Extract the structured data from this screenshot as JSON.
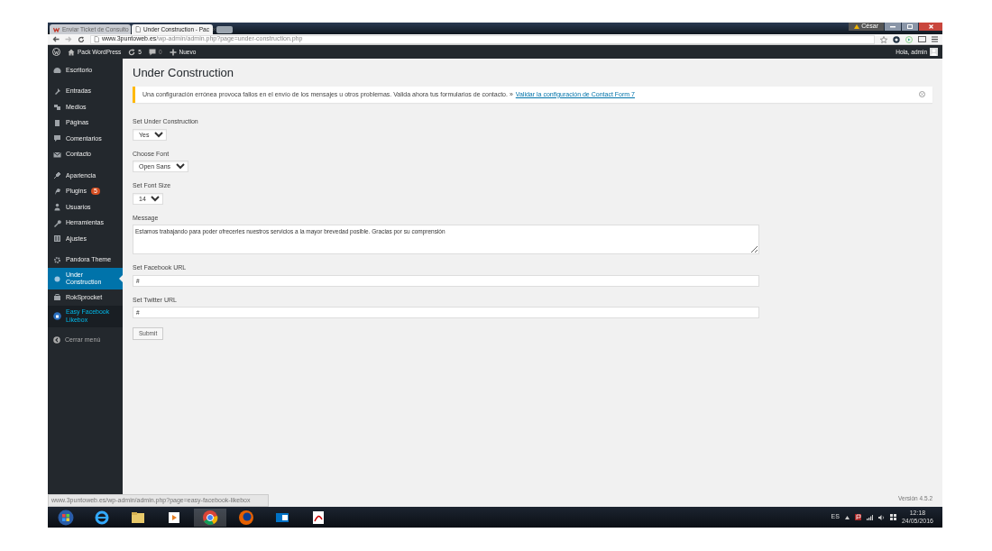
{
  "browser": {
    "tabs": [
      {
        "title": "Enviar Ticket de Consulto",
        "selected": false
      },
      {
        "title": "Under Construction - Pac",
        "selected": true
      }
    ],
    "user_badge": "César",
    "url_host": "www.3puntoweb.es",
    "url_path": "/wp-admin/admin.php?page=under-construction.php"
  },
  "admin_bar": {
    "site": "Pack WordPress",
    "updates": "5",
    "comments": "0",
    "new": "Nuevo",
    "greeting": "Hola, admin"
  },
  "sidebar": {
    "groups": [
      [
        {
          "label": "Escritorio",
          "selected": false,
          "hovered": false
        }
      ],
      [
        {
          "label": "Entradas",
          "selected": false,
          "hovered": false
        },
        {
          "label": "Medios",
          "selected": false,
          "hovered": false
        },
        {
          "label": "Páginas",
          "selected": false,
          "hovered": false
        },
        {
          "label": "Comentarios",
          "selected": false,
          "hovered": false
        },
        {
          "label": "Contacto",
          "selected": false,
          "hovered": false
        }
      ],
      [
        {
          "label": "Apariencia",
          "selected": false,
          "hovered": false
        },
        {
          "label": "Plugins",
          "badge": "5",
          "selected": false,
          "hovered": false
        },
        {
          "label": "Usuarios",
          "selected": false,
          "hovered": false
        },
        {
          "label": "Herramientas",
          "selected": false,
          "hovered": false
        },
        {
          "label": "Ajustes",
          "selected": false,
          "hovered": false
        }
      ],
      [
        {
          "label": "Pandora Theme",
          "selected": false,
          "hovered": false
        },
        {
          "label": "Under Construction",
          "selected": true,
          "hovered": false
        },
        {
          "label": "RokSprocket",
          "selected": false,
          "hovered": false
        },
        {
          "label": "Easy Facebook Likebox",
          "selected": false,
          "hovered": true
        }
      ]
    ],
    "collapse": "Cerrar menú"
  },
  "page": {
    "title": "Under Construction",
    "notice": {
      "text": "Una configuración errónea provoca fallos en el envío de los mensajes u otros problemas. Valida ahora tus formularios de contacto. »",
      "link": "Validar la configuración de Contact Form 7"
    },
    "fields": [
      {
        "kind": "select",
        "label": "Set Under Construction",
        "value": "Yes"
      },
      {
        "kind": "select",
        "label": "Choose Font",
        "value": "Open Sans"
      },
      {
        "kind": "select",
        "label": "Set Font Size",
        "value": "14"
      },
      {
        "kind": "textarea",
        "label": "Message",
        "value": "Estamos trabajando para poder ofrecerles nuestros servicios a la mayor brevedad posible. Gracias por su comprensión"
      },
      {
        "kind": "text",
        "label": "Set Facebook URL",
        "value": "#"
      },
      {
        "kind": "text",
        "label": "Set Twitter URL",
        "value": "#"
      }
    ],
    "submit": "Submit",
    "version": "Versión 4.5.2"
  },
  "status_url": "www.3puntoweb.es/wp-admin/admin.php?page=easy-facebook-likebox",
  "taskbar": {
    "language": "ES",
    "time": "12:18",
    "date": "24/05/2016"
  }
}
